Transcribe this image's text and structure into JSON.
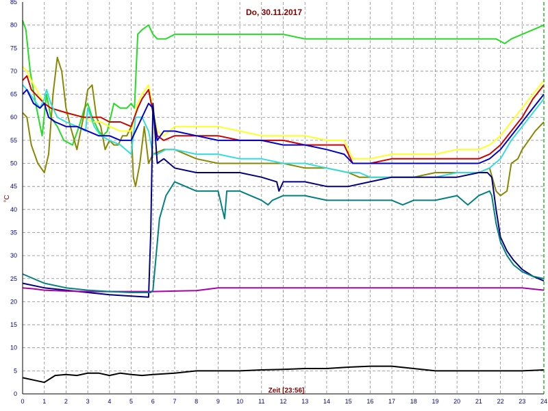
{
  "chart_data": {
    "type": "line",
    "title": "Do, 30.11.2017",
    "xlabel": "Zeit [23:56]",
    "ylabel": "°C",
    "xlim": [
      0,
      24
    ],
    "ylim": [
      0,
      85
    ],
    "x_ticks": [
      "0",
      "1",
      "2",
      "3",
      "4",
      "5",
      "6",
      "7",
      "8",
      "9",
      "10",
      "11",
      "12",
      "13",
      "14",
      "15",
      "16",
      "17",
      "18",
      "19",
      "20",
      "21",
      "22",
      "23",
      "24"
    ],
    "y_ticks": [
      "0",
      "5",
      "10",
      "15",
      "20",
      "25",
      "30",
      "35",
      "40",
      "45",
      "50",
      "55",
      "60",
      "65",
      "70",
      "75",
      "80",
      "85"
    ],
    "grid": true,
    "now_marker_x": 24,
    "series": [
      {
        "color": "#22dd22",
        "x": [
          0,
          0.15,
          0.35,
          0.6,
          0.9,
          1.1,
          1.3,
          1.6,
          1.9,
          2.3,
          2.6,
          2.85,
          3.0,
          3.2,
          3.5,
          3.7,
          3.9,
          4.2,
          4.5,
          4.8,
          5.0,
          5.15,
          5.3,
          5.5,
          5.8,
          6.0,
          6.2,
          6.6,
          7.0,
          8.0,
          9.0,
          10.0,
          11.0,
          12.0,
          13.0,
          14.0,
          15.0,
          16.0,
          17.0,
          18.0,
          19.0,
          20.0,
          21.0,
          21.5,
          21.8,
          22.2,
          22.5,
          23.0,
          23.5,
          24.0
        ],
        "y": [
          81,
          79,
          70,
          63,
          56,
          65,
          60,
          58,
          55,
          54,
          58,
          62,
          63,
          60,
          57,
          56,
          57,
          63,
          62,
          62,
          63,
          62,
          78,
          79,
          80,
          78,
          77,
          77,
          78,
          78,
          78,
          78,
          78,
          78,
          77,
          77,
          77,
          77,
          77,
          77,
          77,
          77,
          77,
          77,
          77,
          76,
          77,
          78,
          79,
          80
        ]
      },
      {
        "color": "#888800",
        "x": [
          0,
          0.2,
          0.4,
          0.7,
          1.0,
          1.2,
          1.4,
          1.6,
          1.8,
          2.0,
          2.2,
          2.5,
          2.8,
          3.0,
          3.2,
          3.4,
          3.6,
          3.8,
          4.0,
          4.2,
          4.4,
          4.6,
          4.8,
          5.0,
          5.1,
          5.2,
          5.4,
          5.6,
          5.8,
          6.0,
          6.5,
          7.0,
          8.0,
          9.0,
          10.0,
          11.0,
          12.0,
          13.0,
          14.0,
          15.0,
          15.5,
          16.0,
          17.0,
          18.0,
          19.0,
          20.0,
          21.0,
          21.5,
          21.8,
          22.0,
          22.3,
          22.5,
          22.8,
          23.0,
          23.3,
          23.6,
          24.0
        ],
        "y": [
          61,
          60,
          54,
          50,
          48,
          52,
          65,
          73,
          70,
          62,
          58,
          53,
          60,
          66,
          67,
          60,
          58,
          53,
          55,
          54,
          54,
          56,
          56,
          58,
          47,
          45,
          50,
          58,
          50,
          52,
          53,
          53,
          51,
          50,
          50,
          50,
          50,
          49,
          49,
          48,
          47,
          47,
          47,
          47,
          48,
          48,
          48,
          49,
          44,
          43,
          44,
          50,
          51,
          53,
          55,
          57,
          59
        ]
      },
      {
        "color": "#ffff22",
        "x": [
          0,
          0.2,
          0.4,
          1.0,
          1.3,
          2.0,
          2.8,
          3.2,
          3.6,
          4.0,
          4.5,
          5.0,
          5.3,
          5.5,
          5.8,
          6.0,
          6.2,
          6.5,
          7.0,
          8.0,
          9.0,
          10.0,
          11.0,
          12.0,
          13.0,
          14.0,
          14.8,
          15.2,
          16.0,
          17.0,
          18.0,
          19.0,
          20.0,
          21.0,
          21.5,
          22.0,
          22.5,
          23.0,
          23.5,
          24.0
        ],
        "y": [
          71,
          70,
          68,
          63,
          62,
          61,
          60,
          59,
          59,
          58,
          57,
          57,
          63,
          65,
          67,
          62,
          57,
          56,
          58,
          58,
          58,
          57,
          56,
          56,
          56,
          55,
          55,
          51,
          51,
          52,
          52,
          52,
          53,
          53,
          54,
          56,
          59,
          62,
          65,
          68
        ]
      },
      {
        "color": "#cc0000",
        "x": [
          0,
          0.2,
          0.4,
          1.0,
          1.3,
          2.0,
          2.8,
          3.2,
          3.6,
          4.0,
          4.5,
          5.0,
          5.3,
          5.5,
          5.8,
          6.0,
          6.2,
          6.5,
          7.0,
          8.0,
          9.0,
          10.0,
          11.0,
          12.0,
          13.0,
          14.0,
          14.8,
          15.2,
          16.0,
          17.0,
          18.0,
          19.0,
          20.0,
          21.0,
          21.5,
          22.0,
          22.5,
          23.0,
          23.5,
          24.0
        ],
        "y": [
          68,
          69,
          66,
          63,
          62,
          61,
          60,
          60,
          60,
          59,
          59,
          58,
          62,
          64,
          66,
          61,
          56,
          55,
          56,
          56,
          56,
          55,
          55,
          55,
          54,
          54,
          54,
          50,
          50,
          51,
          51,
          51,
          51,
          51,
          52,
          54,
          57,
          60,
          64,
          67
        ]
      },
      {
        "color": "#33dddd",
        "x": [
          0,
          0.2,
          0.5,
          0.8,
          1.0,
          1.1,
          1.3,
          1.6,
          2.0,
          2.5,
          2.9,
          3.0,
          3.3,
          3.6,
          4.0,
          4.5,
          5.0,
          5.2,
          5.5,
          5.8,
          6.0,
          6.2,
          6.6,
          7.0,
          8.0,
          9.0,
          10.0,
          11.0,
          12.0,
          13.0,
          14.0,
          15.0,
          15.5,
          16.0,
          17.0,
          18.0,
          19.0,
          20.0,
          21.0,
          21.5,
          22.0,
          22.5,
          23.0,
          23.5,
          24.0
        ],
        "y": [
          67,
          66,
          64,
          62,
          64,
          66,
          63,
          60,
          59,
          58,
          57,
          62,
          58,
          56,
          55,
          54,
          52,
          60,
          60,
          57,
          52,
          52,
          53,
          53,
          52,
          52,
          51,
          51,
          50,
          50,
          49,
          48,
          48,
          47,
          47,
          47,
          47,
          48,
          48,
          49,
          51,
          55,
          58,
          61,
          64
        ]
      },
      {
        "color": "#0000cc",
        "x": [
          0,
          0.2,
          0.5,
          0.8,
          1.0,
          1.2,
          1.5,
          2.0,
          2.5,
          3.0,
          3.5,
          4.0,
          4.5,
          5.0,
          5.5,
          5.8,
          6.0,
          6.2,
          6.5,
          7.0,
          8.0,
          9.0,
          10.0,
          11.0,
          12.0,
          13.0,
          14.0,
          14.8,
          15.2,
          16.0,
          17.0,
          18.0,
          19.0,
          20.0,
          21.0,
          21.5,
          22.0,
          22.5,
          23.0,
          23.5,
          24.0
        ],
        "y": [
          65,
          66,
          63,
          62,
          63,
          60,
          59,
          58,
          58,
          57,
          56,
          56,
          55,
          55,
          60,
          63,
          62,
          55,
          57,
          57,
          56,
          55,
          55,
          55,
          54,
          54,
          53,
          52,
          50,
          50,
          50,
          50,
          50,
          50,
          50,
          51,
          53,
          56,
          59,
          62,
          65
        ]
      },
      {
        "color": "#000080",
        "x": [
          0,
          1,
          2,
          3,
          4,
          5,
          5.8,
          5.9,
          6.0,
          6.2,
          6.5,
          7.0,
          8.0,
          9.0,
          10.0,
          11.0,
          11.7,
          11.8,
          12.0,
          13.0,
          14.0,
          15.0,
          16.0,
          17.0,
          18.0,
          19.0,
          20.0,
          21.0,
          21.4,
          21.6,
          21.8,
          22.0,
          22.3,
          22.6,
          23.0,
          23.5,
          24.0
        ],
        "y": [
          24,
          23,
          22.5,
          22,
          21.5,
          21.2,
          21,
          35,
          63,
          50,
          51,
          49,
          48,
          48,
          48,
          47,
          46,
          44,
          46,
          46,
          45,
          45,
          46,
          47,
          47,
          47,
          47,
          48,
          48,
          47,
          40,
          34,
          31,
          29,
          27,
          25.5,
          24.5
        ]
      },
      {
        "color": "#aa00aa",
        "x": [
          0,
          0.5,
          1,
          2,
          3,
          4,
          5,
          6,
          7,
          8,
          9,
          10,
          11,
          12,
          13,
          14,
          15,
          16,
          17,
          18,
          19,
          20,
          21,
          22,
          23,
          24
        ],
        "y": [
          23,
          22.8,
          22.5,
          22.3,
          22.2,
          22.2,
          22.2,
          22.2,
          22.3,
          22.4,
          23,
          23,
          23,
          23,
          23,
          23,
          23,
          23,
          23,
          23,
          23,
          23,
          23,
          23,
          23,
          22.5
        ]
      },
      {
        "color": "#008080",
        "x": [
          0,
          1,
          2,
          3,
          4,
          5,
          5.8,
          5.9,
          6.0,
          6.3,
          6.6,
          7.0,
          8.0,
          9.0,
          9.3,
          9.4,
          9.5,
          10.0,
          11.0,
          11.3,
          11.5,
          12.0,
          13.0,
          14.0,
          15.0,
          16.0,
          17.0,
          17.5,
          18.0,
          19.0,
          20.0,
          20.5,
          21.0,
          21.5,
          21.6,
          21.8,
          22.0,
          22.3,
          22.6,
          23.0,
          23.5,
          24.0
        ],
        "y": [
          26,
          24,
          23,
          22.5,
          22.2,
          22,
          22,
          22,
          22.5,
          38,
          43,
          46,
          44,
          44,
          38,
          44,
          44,
          44,
          42,
          41,
          42,
          43,
          43,
          42,
          42,
          42,
          42,
          41,
          42,
          42,
          43,
          41,
          43,
          44,
          43,
          37,
          33,
          30,
          28,
          26.5,
          25.5,
          25
        ]
      },
      {
        "color": "#000000",
        "x": [
          0,
          0.5,
          1,
          1.5,
          2,
          2.5,
          3,
          3.5,
          4,
          4.5,
          5,
          5.5,
          6,
          7,
          8,
          9,
          10,
          11,
          12,
          13,
          14,
          15,
          16,
          17,
          18,
          19,
          20,
          21,
          22,
          23,
          24
        ],
        "y": [
          3.5,
          3,
          2.5,
          4,
          4.2,
          4,
          4.5,
          4.5,
          4,
          4.5,
          4.2,
          4,
          4.2,
          4.5,
          5,
          5,
          5,
          5.2,
          5.3,
          5.5,
          5.5,
          5.8,
          6,
          6,
          5.5,
          5,
          5,
          5,
          5,
          5,
          5.2
        ]
      }
    ]
  }
}
